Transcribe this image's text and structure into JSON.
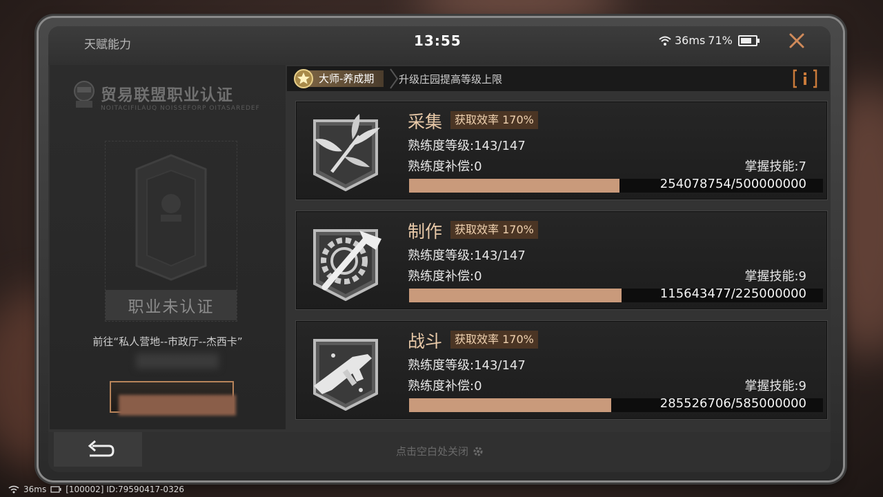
{
  "header": {
    "title": "天赋能力",
    "time": "13:55",
    "ping": "36ms",
    "battery": "71%"
  },
  "left": {
    "cert_title": "贸易联盟职业认证",
    "cert_subtitle": "NOITACIFILAUQ NOISSEFORP OITASAREDEF",
    "status": "职业未认证",
    "goto_text": "前往“私人营地--市政厅--杰西卡”"
  },
  "rank": {
    "label": "大师-养成期",
    "description": "升级庄园提高等级上限"
  },
  "skills": [
    {
      "name": "采集",
      "efficiency": "获取效率 170%",
      "level": "熟练度等级:143/147",
      "compensation": "熟练度补偿:0",
      "mastery": "掌握技能:7",
      "progress_text": "254078754/500000000",
      "progress": 0.508,
      "icon": "herb-icon"
    },
    {
      "name": "制作",
      "efficiency": "获取效率 170%",
      "level": "熟练度等级:143/147",
      "compensation": "熟练度补偿:0",
      "mastery": "掌握技能:9",
      "progress_text": "115643477/225000000",
      "progress": 0.514,
      "icon": "hammer-gear-icon"
    },
    {
      "name": "战斗",
      "efficiency": "获取效率 170%",
      "level": "熟练度等级:143/147",
      "compensation": "熟练度补偿:0",
      "mastery": "掌握技能:9",
      "progress_text": "285526706/585000000",
      "progress": 0.488,
      "icon": "smg-icon"
    }
  ],
  "bottom": {
    "close_hint": "点击空白处关闭"
  },
  "footer": {
    "ping": "36ms",
    "id": "[100002] ID:79590417-0326"
  },
  "colors": {
    "accent": "#c99a7b",
    "tag_bg": "#4b3524",
    "close": "#d08a5a"
  }
}
